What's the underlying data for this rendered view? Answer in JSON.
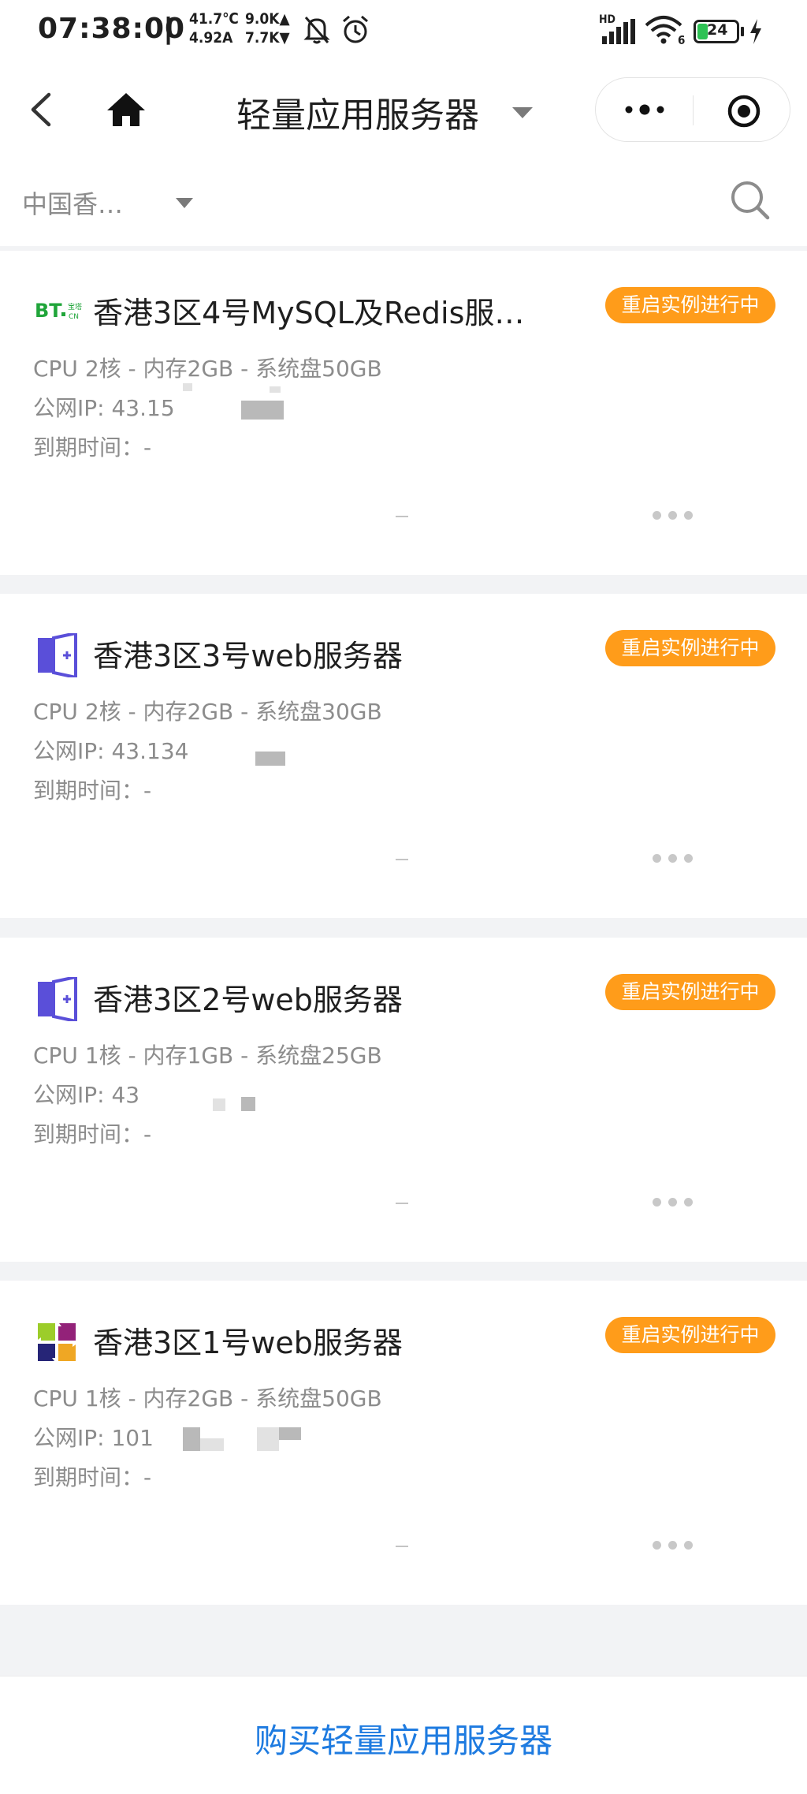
{
  "status_bar": {
    "time": "07:38:00",
    "separator": "|",
    "temperature": "41.7℃",
    "current": "4.92A",
    "upload_speed": "9.0K▲",
    "download_speed": "7.7K▼",
    "network_label": "HD",
    "wifi_label": "6",
    "battery": "24"
  },
  "nav": {
    "title": "轻量应用服务器"
  },
  "filter": {
    "region": "中国香…"
  },
  "servers": [
    {
      "name": "香港3区4号MySQL及Redis服…",
      "icon": "bt-panel-icon",
      "status": "重启实例进行中",
      "spec": "CPU 2核 - 内存2GB - 系统盘50GB",
      "ip_label": "公网IP: ",
      "ip_value": "43.15",
      "expire": "到期时间：-"
    },
    {
      "name": "香港3区3号web服务器",
      "icon": "windows-door-icon",
      "status": "重启实例进行中",
      "spec": "CPU 2核 - 内存2GB - 系统盘30GB",
      "ip_label": "公网IP: ",
      "ip_value": "43.134",
      "expire": "到期时间：-"
    },
    {
      "name": "香港3区2号web服务器",
      "icon": "windows-door-icon",
      "status": "重启实例进行中",
      "spec": "CPU 1核 - 内存1GB - 系统盘25GB",
      "ip_label": "公网IP: ",
      "ip_value": "43",
      "expire": "到期时间：-"
    },
    {
      "name": "香港3区1号web服务器",
      "icon": "centos-logo-icon",
      "status": "重启实例进行中",
      "spec": "CPU 1核 - 内存2GB - 系统盘50GB",
      "ip_label": "公网IP: ",
      "ip_value": "101",
      "expire": "到期时间：-"
    }
  ],
  "footer": {
    "buy_label": "购买轻量应用服务器"
  },
  "colors": {
    "badge": "#ff9c1a",
    "link": "#1e7be0",
    "bt_green": "#20a53a",
    "windows_purple": "#5a4fd9"
  }
}
